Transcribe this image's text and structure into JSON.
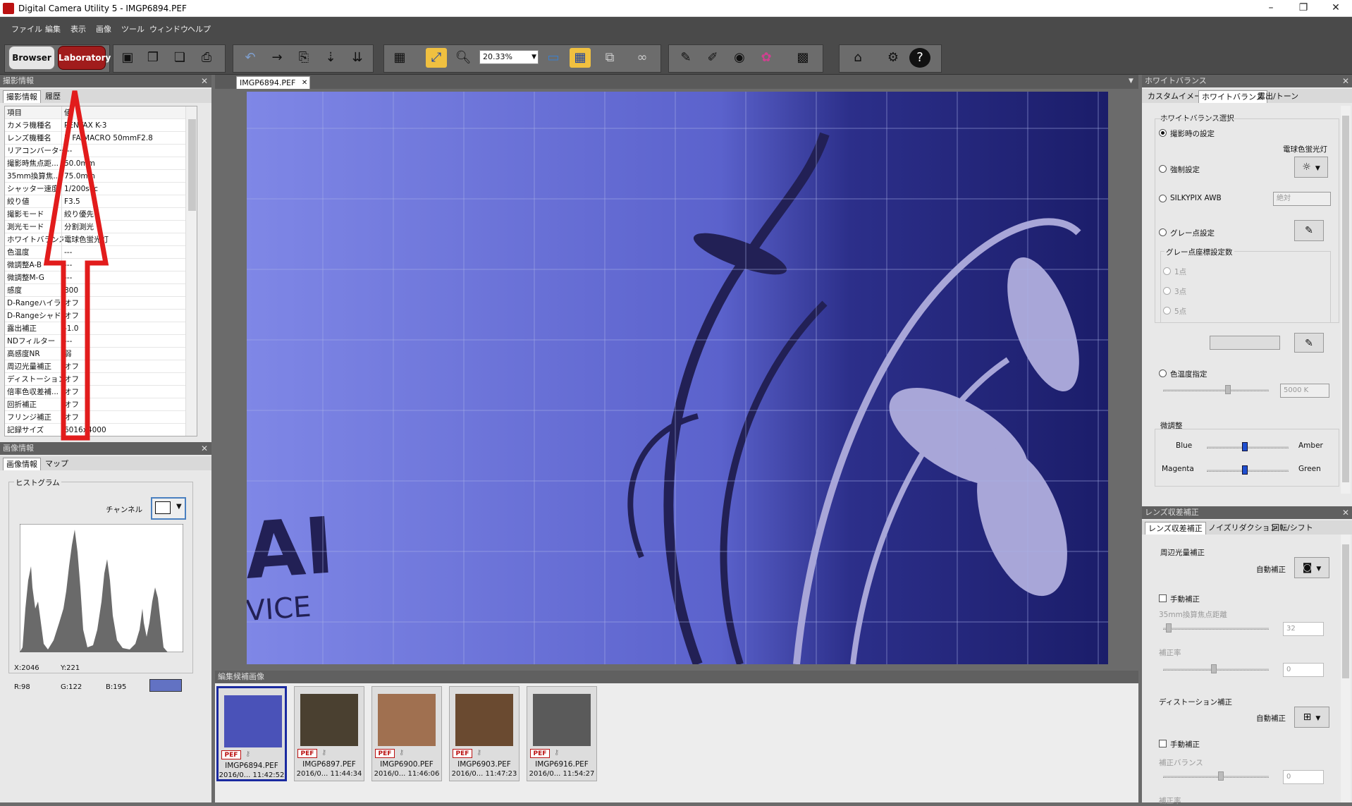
{
  "window": {
    "title": "Digital Camera Utility 5 - IMGP6894.PEF",
    "controls": [
      "–",
      "❐",
      "✕"
    ]
  },
  "menu": [
    "ファイル",
    "編集",
    "表示",
    "画像",
    "ツール",
    "ウィンドウ",
    "ヘルプ"
  ],
  "toolbar": {
    "browser_label": "Browser",
    "laboratory_label": "Laboratory",
    "zoom_value": "20.33%"
  },
  "shooting_panel": {
    "title": "撮影情報",
    "tabs": [
      "撮影情報",
      "履歴"
    ],
    "header_key": "項目",
    "header_value": "値",
    "rows": [
      {
        "k": "カメラ機種名",
        "v": "PENTAX K-3"
      },
      {
        "k": "レンズ機種名",
        "v": "D FA MACRO 50mmF2.8"
      },
      {
        "k": "リアコンバーター",
        "v": "---"
      },
      {
        "k": "撮影時焦点距...",
        "v": "50.0mm"
      },
      {
        "k": "35mm換算焦...",
        "v": "75.0mm"
      },
      {
        "k": "シャッター速度",
        "v": "1/200sec"
      },
      {
        "k": "絞り値",
        "v": "F3.5"
      },
      {
        "k": "撮影モード",
        "v": "絞り優先"
      },
      {
        "k": "測光モード",
        "v": "分割測光"
      },
      {
        "k": "ホワイトバランス",
        "v": "電球色蛍光灯"
      },
      {
        "k": "色温度",
        "v": "---"
      },
      {
        "k": "微調整A-B",
        "v": "---"
      },
      {
        "k": "微調整M-G",
        "v": "---"
      },
      {
        "k": "感度",
        "v": "800"
      },
      {
        "k": "D-Rangeハイラ...",
        "v": "オフ"
      },
      {
        "k": "D-Rangeシャド...",
        "v": "オフ"
      },
      {
        "k": "露出補正",
        "v": "-1.0"
      },
      {
        "k": "NDフィルター",
        "v": "---"
      },
      {
        "k": "高感度NR",
        "v": "弱"
      },
      {
        "k": "周辺光量補正",
        "v": "オフ"
      },
      {
        "k": "ディストーション...",
        "v": "オフ"
      },
      {
        "k": "倍率色収差補...",
        "v": "オフ"
      },
      {
        "k": "回折補正",
        "v": "オフ"
      },
      {
        "k": "フリンジ補正",
        "v": "オフ"
      },
      {
        "k": "記録サイズ",
        "v": "6016x4000"
      }
    ]
  },
  "image_panel": {
    "title": "画像情報",
    "tabs": [
      "画像情報",
      "マップ"
    ],
    "histogram_label": "ヒストグラム",
    "channel_label": "チャンネル",
    "x": "X:2046",
    "y": "Y:221",
    "r": "R:98",
    "g": "G:122",
    "b": "B:195",
    "swatch_color": "#6272c3"
  },
  "document_tab": "IMGP6894.PEF",
  "filmstrip": {
    "title": "編集候補画像",
    "items": [
      {
        "name": "IMGP6894.PEF",
        "date": "2016/0... 11:42:52",
        "badge": "PEF",
        "color": "#4a52b8"
      },
      {
        "name": "IMGP6897.PEF",
        "date": "2016/0... 11:44:34",
        "badge": "PEF",
        "color": "#4a4030"
      },
      {
        "name": "IMGP6900.PEF",
        "date": "2016/0... 11:46:06",
        "badge": "PEF",
        "color": "#a07050"
      },
      {
        "name": "IMGP6903.PEF",
        "date": "2016/0... 11:47:23",
        "badge": "PEF",
        "color": "#6a4a30"
      },
      {
        "name": "IMGP6916.PEF",
        "date": "2016/0... 11:54:27",
        "badge": "PEF",
        "color": "#5a5a5a"
      }
    ]
  },
  "wb_panel": {
    "title": "ホワイトバランス",
    "tabs": [
      "カスタムイメージ",
      "ホワイトバランス",
      "露出/トーン"
    ],
    "section": "ホワイトバランス選択",
    "opt_shooting": "撮影時の設定",
    "current_wb": "電球色蛍光灯",
    "opt_forced": "強制設定",
    "opt_silkypix": "SILKYPIX AWB",
    "silkypix_mode": "絶対",
    "opt_gray": "グレー点設定",
    "gray_count_label": "グレー点座標設定数",
    "gray_1": "1点",
    "gray_3": "3点",
    "gray_5": "5点",
    "opt_temp": "色温度指定",
    "temp_value": "5000 K",
    "fine_label": "微調整",
    "blue": "Blue",
    "amber": "Amber",
    "magenta": "Magenta",
    "green": "Green"
  },
  "lens_panel": {
    "title": "レンズ収差補正",
    "tabs": [
      "レンズ収差補正",
      "ノイズリダクション",
      "回転/シフト"
    ],
    "vignetting": "周辺光量補正",
    "auto1": "自動補正",
    "manual1": "手動補正",
    "focal_label": "35mm換算焦点距離",
    "focal_value": "32",
    "amount_label": "補正率",
    "amount_value": "0",
    "distortion": "ディストーション補正",
    "auto2": "自動補正",
    "manual2": "手動補正",
    "balance_label": "補正バランス",
    "balance_value": "0",
    "amount2_label": "補正率"
  }
}
